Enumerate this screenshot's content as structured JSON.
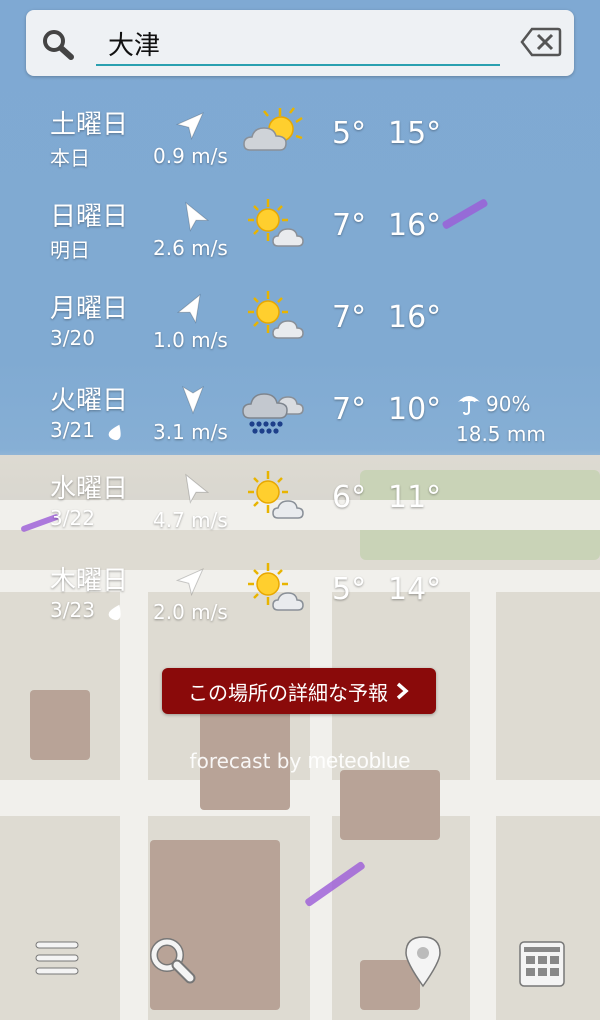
{
  "search": {
    "value": "大津"
  },
  "forecast": [
    {
      "day": "土曜日",
      "sub": "本日",
      "wind": "0.9 m/s",
      "wind_dir_deg": 45,
      "icon": "sun-behind-cloud-icon",
      "tmin": "5°",
      "tmax": "15°",
      "rain_icon": false
    },
    {
      "day": "日曜日",
      "sub": "明日",
      "wind": "2.6 m/s",
      "wind_dir_deg": -30,
      "icon": "sun-small-cloud-icon",
      "tmin": "7°",
      "tmax": "16°",
      "rain_icon": false
    },
    {
      "day": "月曜日",
      "sub": "3/20",
      "wind": "1.0 m/s",
      "wind_dir_deg": 30,
      "icon": "sun-small-cloud-icon",
      "tmin": "7°",
      "tmax": "16°",
      "rain_icon": false
    },
    {
      "day": "火曜日",
      "sub": "3/21",
      "wind": "3.1 m/s",
      "wind_dir_deg": 180,
      "icon": "rain-cloud-icon",
      "tmin": "7°",
      "tmax": "10°",
      "rain_icon": true,
      "precip_prob": "90%",
      "precip_amount": "18.5 mm"
    },
    {
      "day": "水曜日",
      "sub": "3/22",
      "wind": "4.7 m/s",
      "wind_dir_deg": -30,
      "icon": "sun-small-cloud-icon",
      "tmin": "6°",
      "tmax": "11°",
      "rain_icon": false
    },
    {
      "day": "木曜日",
      "sub": "3/23",
      "wind": "2.0 m/s",
      "wind_dir_deg": 45,
      "icon": "sun-small-cloud-icon",
      "tmin": "5°",
      "tmax": "14°",
      "rain_icon": true
    }
  ],
  "detail_button": {
    "label": "この場所の詳細な予報"
  },
  "credit": {
    "prefix": "forecast by",
    "brand": "meteoblue"
  },
  "nav": {
    "items": [
      "menu-icon",
      "search-icon",
      "location-pin-icon",
      "grid-icon"
    ]
  },
  "colors": {
    "accent": "#2aa0b0",
    "detail_button": "#8a0a0a",
    "sky": "#7fa9d3"
  }
}
